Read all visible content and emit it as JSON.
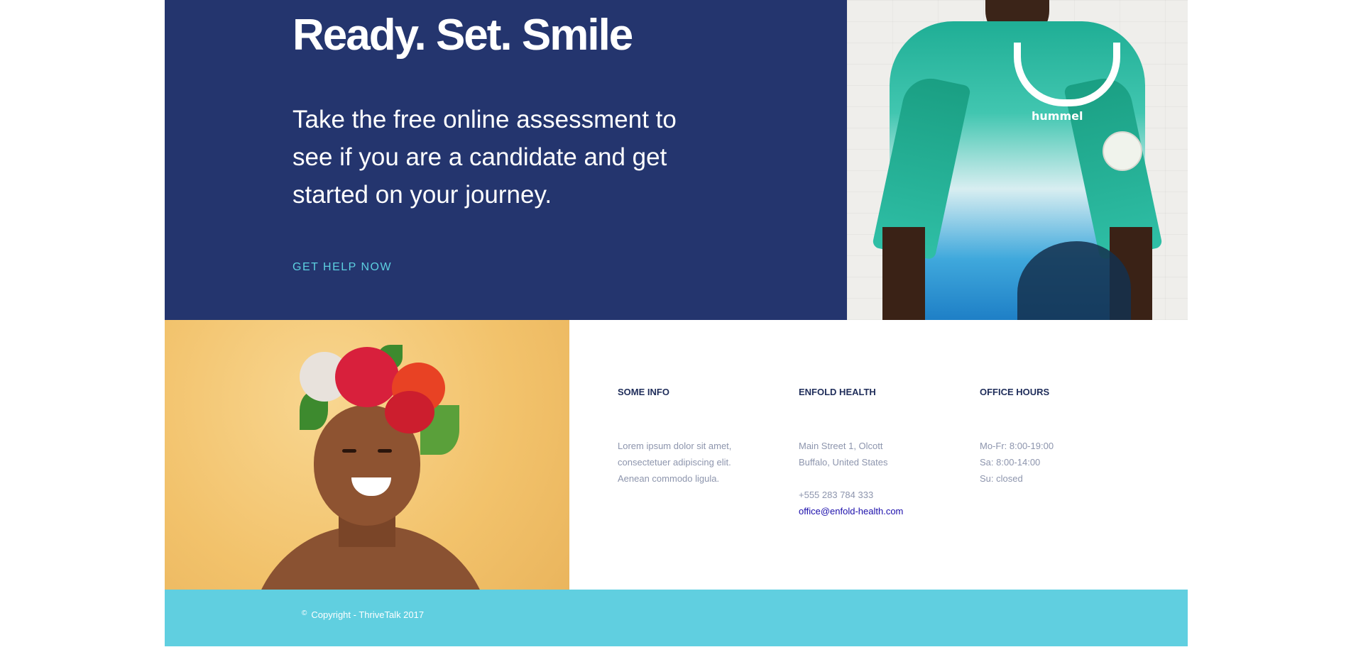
{
  "hero": {
    "title": "Ready. Set. Smile",
    "text": "Take the free online assessment to see if you are a candidate and get started on your journey.",
    "cta": "GET HELP NOW",
    "brand_on_shirt": "hummel"
  },
  "info": {
    "col1": {
      "heading": "SOME INFO",
      "lines": [
        "Lorem ipsum dolor sit amet,",
        "consectetuer adipiscing elit.",
        "Aenean commodo ligula."
      ]
    },
    "col2": {
      "heading": "ENFOLD HEALTH",
      "address": [
        "Main Street 1, Olcott",
        "Buffalo, United States"
      ],
      "phone": "+555 283 784 333",
      "email": "office@enfold-health.com"
    },
    "col3": {
      "heading": "OFFICE HOURS",
      "lines": [
        "Mo-Fr: 8:00-19:00",
        "Sa: 8:00-14:00",
        "Su: closed"
      ]
    }
  },
  "footer": {
    "copyright_icon": "©",
    "copyright": "Copyright - ThriveTalk 2017"
  },
  "colors": {
    "navy": "#24356e",
    "accent": "#5dd0e0",
    "footer": "#60cfe0",
    "heading": "#1f2d5a",
    "muted": "#8d95ad",
    "link": "#1a0dab"
  }
}
